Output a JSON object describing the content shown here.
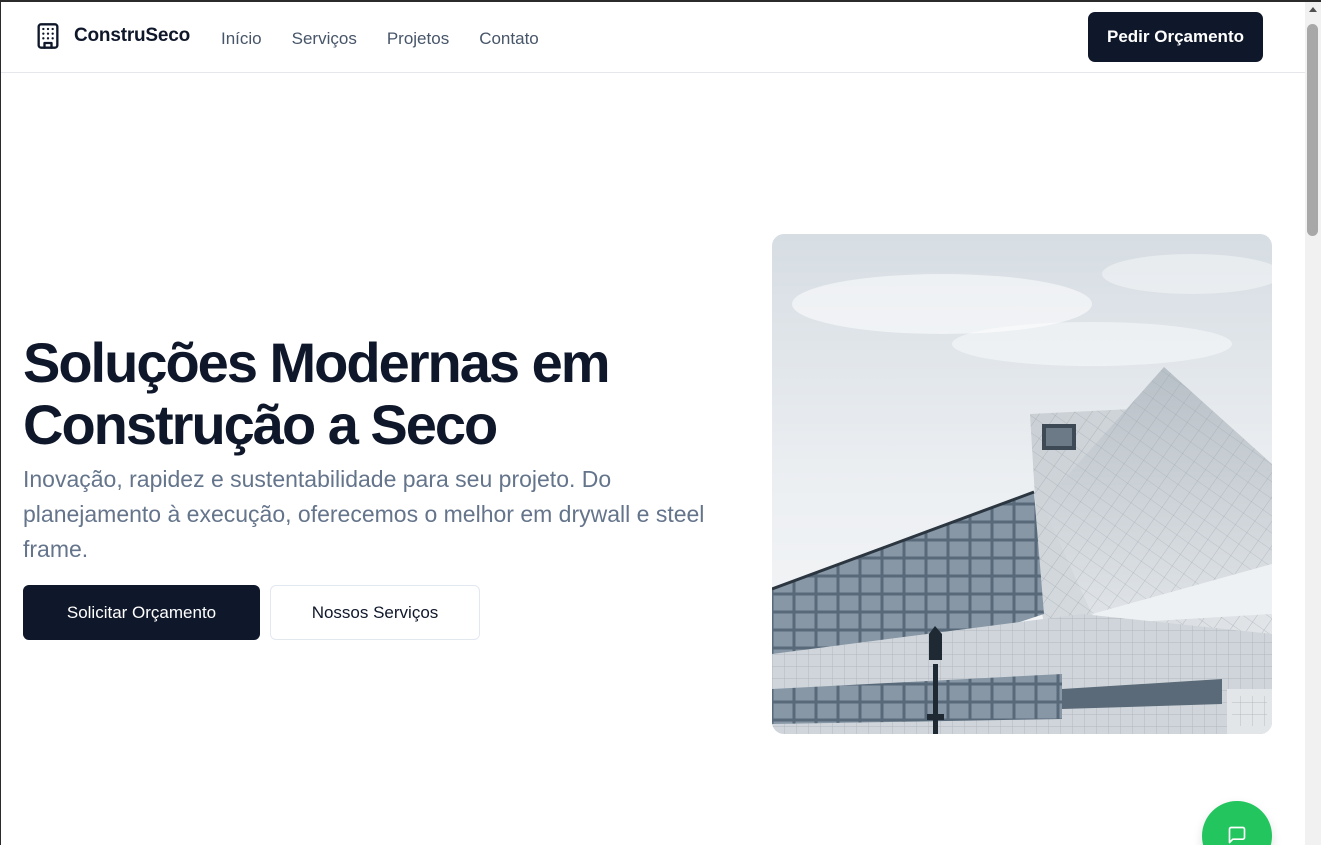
{
  "header": {
    "brand_name": "ConstruSeco",
    "brand_icon": "building-icon",
    "nav": [
      {
        "label": "Início"
      },
      {
        "label": "Serviços"
      },
      {
        "label": "Projetos"
      },
      {
        "label": "Contato"
      }
    ],
    "cta_label": "Pedir Orçamento"
  },
  "hero": {
    "title_line1": "Soluções Modernas em",
    "title_line2": "Construção a Seco",
    "subtitle": "Inovação, rapidez e sustentabilidade para seu projeto. Do planejamento à execução, oferecemos o melhor em drywall e steel frame.",
    "primary_button": "Solicitar Orçamento",
    "secondary_button": "Nossos Serviços"
  },
  "floating": {
    "chat_icon": "message-square-icon",
    "chat_color": "#22c55e"
  },
  "colors": {
    "primary": "#0f172a",
    "muted_text": "#64748b",
    "nav_text": "#475569"
  }
}
